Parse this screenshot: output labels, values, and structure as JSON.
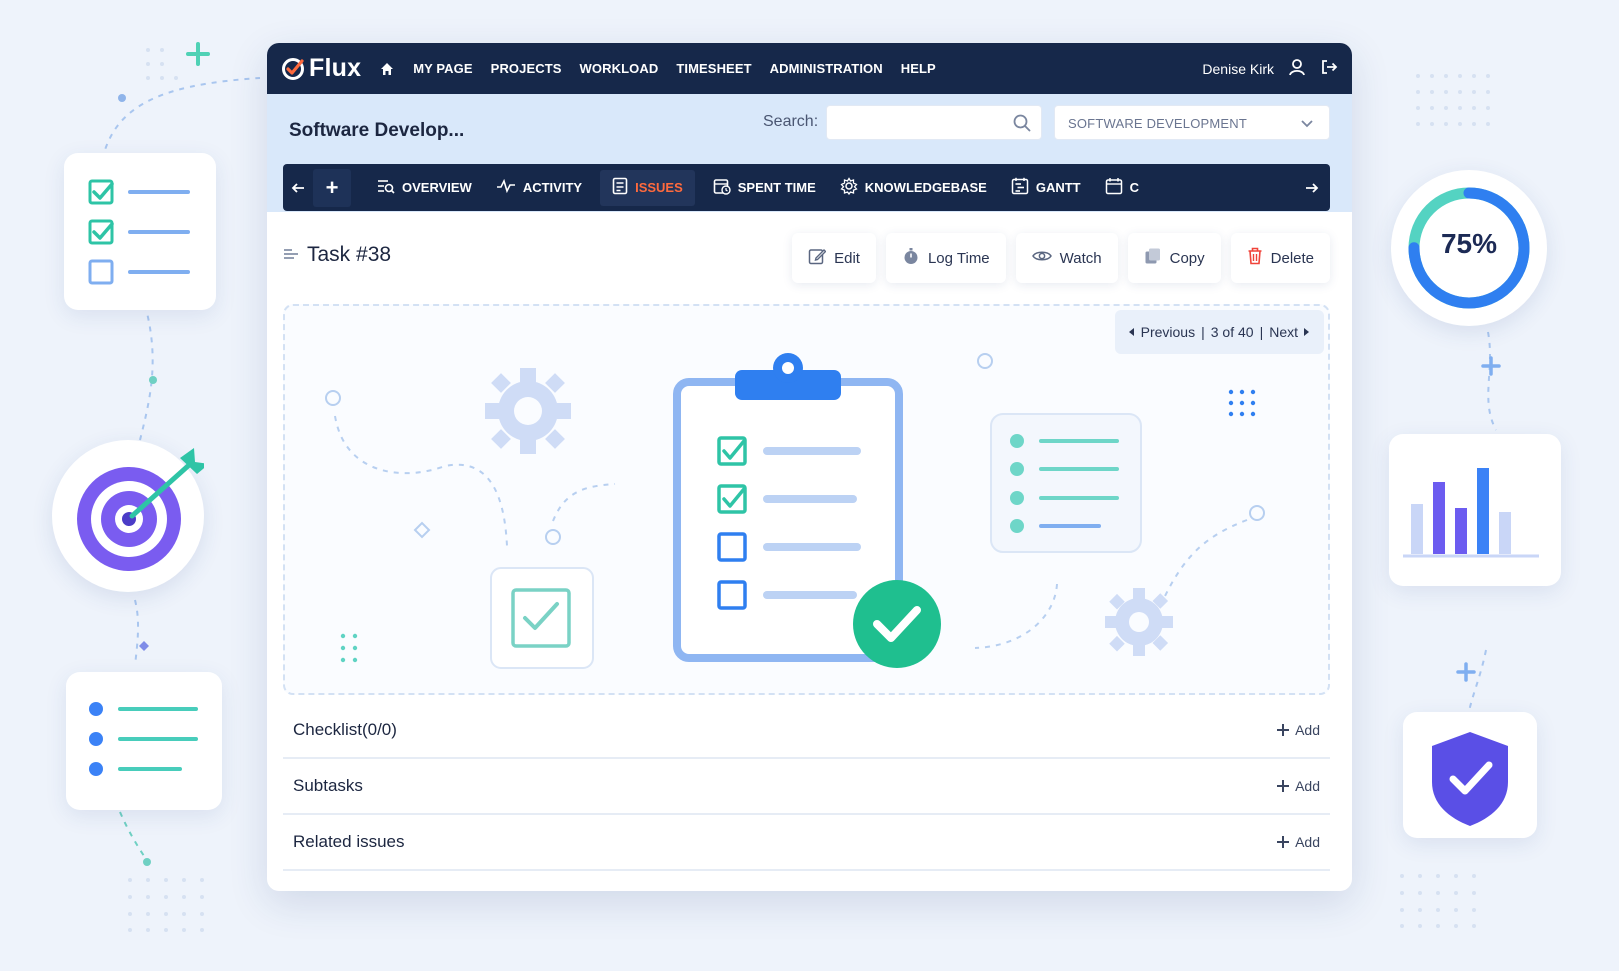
{
  "app": {
    "name": "Flux"
  },
  "nav": {
    "items": [
      "MY PAGE",
      "PROJECTS",
      "WORKLOAD",
      "TIMESHEET",
      "ADMINISTRATION",
      "HELP"
    ],
    "user": "Denise Kirk"
  },
  "project": {
    "title": "Software Develop...",
    "search_label": "Search:",
    "search_value": "",
    "selected_project": "SOFTWARE DEVELOPMENT"
  },
  "tabs": [
    {
      "label": "OVERVIEW",
      "icon": "overview-icon"
    },
    {
      "label": "ACTIVITY",
      "icon": "activity-icon"
    },
    {
      "label": "ISSUES",
      "icon": "issues-icon",
      "active": true
    },
    {
      "label": "SPENT TIME",
      "icon": "spent-time-icon"
    },
    {
      "label": "KNOWLEDGEBASE",
      "icon": "knowledgebase-icon"
    },
    {
      "label": "GANTT",
      "icon": "gantt-icon"
    },
    {
      "label": "C",
      "icon": "calendar-icon"
    }
  ],
  "task": {
    "title": "Task #38",
    "actions": {
      "edit": "Edit",
      "log_time": "Log Time",
      "watch": "Watch",
      "copy": "Copy",
      "delete": "Delete"
    }
  },
  "pager": {
    "previous": "Previous",
    "position": "3 of 40",
    "next": "Next"
  },
  "sections": [
    {
      "title": "Checklist(0/0)",
      "add": "Add"
    },
    {
      "title": "Subtasks",
      "add": "Add"
    },
    {
      "title": "Related issues",
      "add": "Add"
    }
  ],
  "widgets": {
    "progress_label": "75%",
    "progress_value": 0.75
  },
  "colors": {
    "navy": "#16284a",
    "accent_orange": "#ff6a3d",
    "teal": "#2ec4a6",
    "blue": "#3b82f6",
    "purple": "#6c63ff",
    "light_blue": "#d9e8fa"
  }
}
